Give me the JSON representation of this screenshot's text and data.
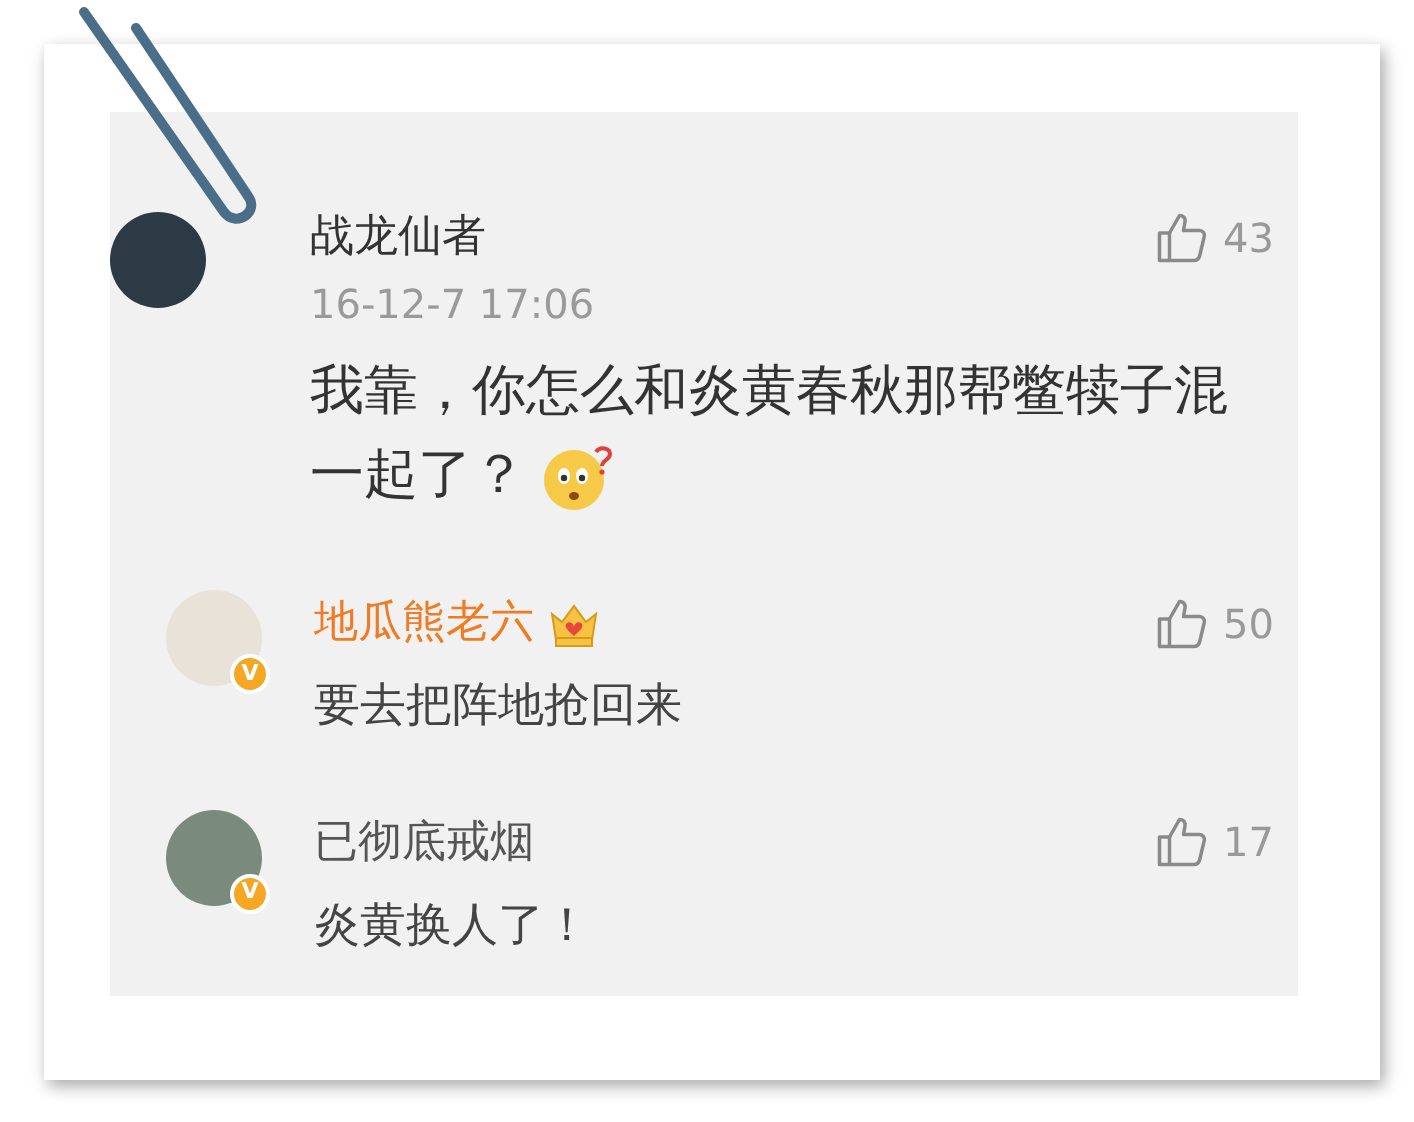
{
  "comment": {
    "name": "战龙仙者",
    "time": "16-12-7 17:06",
    "likes": "43",
    "text": "我靠，你怎么和炎黄春秋那帮鳖犊子混一起了？",
    "emoji": true,
    "replies": [
      {
        "name": "地瓜熊老六",
        "vip": true,
        "badge": "V",
        "likes": "50",
        "text": "要去把阵地抢回来"
      },
      {
        "name": "已彻底戒烟",
        "vip": false,
        "badge": "V",
        "likes": "17",
        "text": "炎黄换人了！"
      }
    ]
  }
}
